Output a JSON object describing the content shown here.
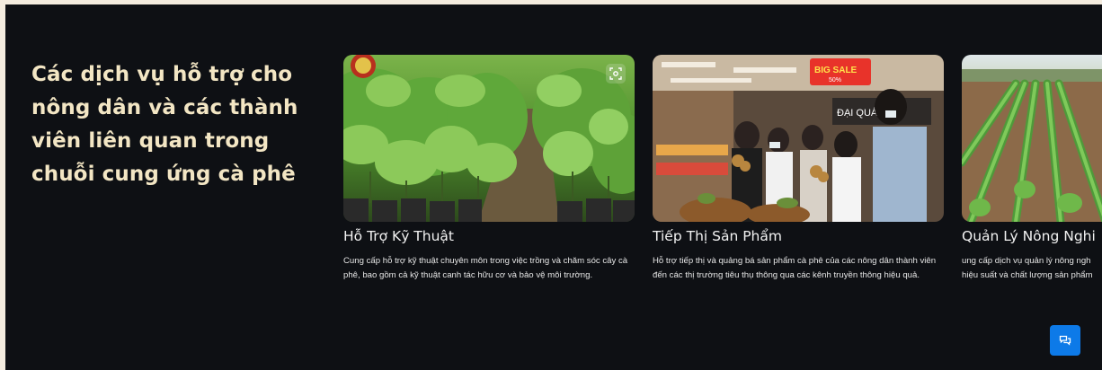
{
  "heading": "Các dịch vụ hỗ trợ cho nông dân và các thành viên liên quan trong chuỗi cung ứng cà phê",
  "cards": [
    {
      "title": "Hỗ Trợ Kỹ Thuật",
      "desc": "Cung cấp hỗ trợ kỹ thuật chuyên môn trong việc trồng và chăm sóc cây cà phê, bao gồm cả kỹ thuật canh tác hữu cơ và bảo vệ môi trường.",
      "image": "coffee-seedlings-nursery"
    },
    {
      "title": "Tiếp Thị Sản Phẩm",
      "desc": "Hỗ trợ tiếp thị và quảng bá sản phẩm cà phê của các nông dân thành viên đến các thị trường tiêu thụ thông qua các kênh truyền thông hiệu quả.",
      "image": "supermarket-fruit-promotion",
      "sign_sale": "BIG SALE",
      "sign_sale_sub": "50%",
      "sign_store": "ĐẠI QUÁ V"
    },
    {
      "title": "Quản Lý Nông Nghi",
      "desc_line1": "ung cấp dịch vụ quản lý nông ngh",
      "desc_line2": "hiệu suất và chất lượng sản phẩm",
      "image": "crop-field-rows"
    }
  ],
  "icons": {
    "scan": "scan-icon",
    "chat": "chat-icon"
  },
  "colors": {
    "background": "#0e1014",
    "heading": "#f3e6c4",
    "chat_button": "#0d7ae8"
  }
}
